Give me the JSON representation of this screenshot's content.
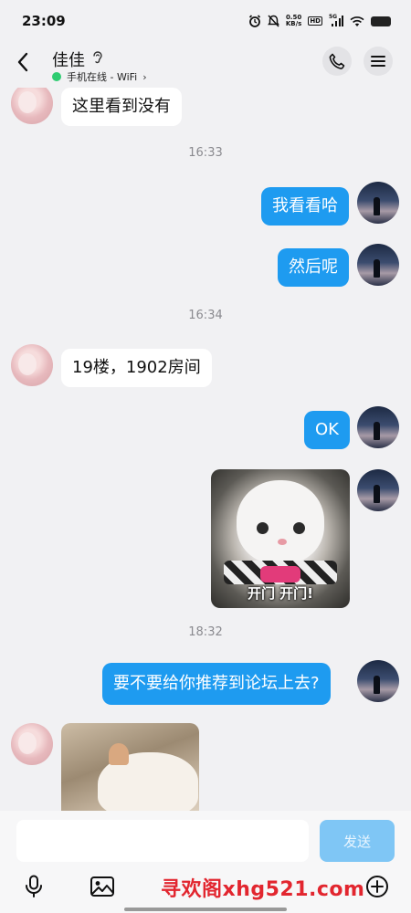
{
  "status_bar": {
    "time": "23:09",
    "net_speed_value": "0.50",
    "net_speed_unit": "KB/s",
    "hd_badge": "HD",
    "signal": "5G",
    "icons": [
      "alarm-icon",
      "mute-icon",
      "signal-icon",
      "wifi-icon",
      "battery-icon"
    ]
  },
  "header": {
    "contact_name": "佳佳",
    "presence": "手机在线 - WiFi",
    "presence_color": "#2ecc71",
    "icons": [
      "back-icon",
      "ear-icon",
      "phone-icon",
      "menu-icon"
    ]
  },
  "messages": [
    {
      "side": "left",
      "type": "text",
      "text": "这里看到没有"
    },
    {
      "type": "time",
      "text": "16:33"
    },
    {
      "side": "right",
      "type": "text",
      "text": "我看看哈"
    },
    {
      "side": "right",
      "type": "text",
      "text": "然后呢"
    },
    {
      "type": "time",
      "text": "16:34"
    },
    {
      "side": "left",
      "type": "text",
      "text": "19楼，1902房间"
    },
    {
      "side": "right",
      "type": "text",
      "text": "OK"
    },
    {
      "side": "right",
      "type": "image",
      "caption": "开门 开门!"
    },
    {
      "type": "time",
      "text": "18:32"
    },
    {
      "side": "right",
      "type": "text",
      "text": "要不要给你推荐到论坛上去?"
    },
    {
      "side": "left",
      "type": "image",
      "caption": ""
    }
  ],
  "input": {
    "value": "",
    "send_label": "发送"
  },
  "toolbar": {
    "icons": [
      "voice-icon",
      "image-icon",
      "add-icon"
    ],
    "watermark": "寻欢阁xhg521.com"
  },
  "colors": {
    "bubble_outgoing": "#1e9bf0",
    "bubble_incoming": "#ffffff",
    "send_button": "#7fc6f5",
    "background": "#f1f1f3"
  }
}
